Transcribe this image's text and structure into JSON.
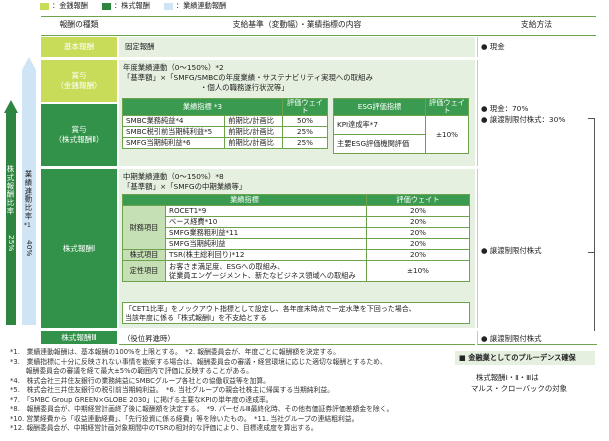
{
  "legend": [
    {
      "label": "：金銭報酬",
      "color": "#c8dc5a"
    },
    {
      "label": "：株式報酬",
      "color": "#2e8540"
    },
    {
      "label": "：業績連動報酬",
      "color": "#cfe4f4"
    }
  ],
  "header": {
    "col1": "報酬の種類",
    "col2": "支給基準（変動幅）・業績指標の内容",
    "col3": "支給方法"
  },
  "left_labels": {
    "stock_ratio": "株式報酬比率",
    "stock_pct": "25%",
    "perf_ratio": "業績連動比率",
    "perf_note": "*1",
    "perf_pct": "40%"
  },
  "rows": {
    "base": {
      "label": "基本報酬",
      "content": "固定報酬",
      "pay": "● 現金"
    },
    "bonus_cash": {
      "label1": "賞与",
      "label2": "（金銭報酬）"
    },
    "bonus_stock": {
      "label1": "賞与",
      "label2": "（株式報酬Ⅱ）"
    },
    "bonus_line1": "年度業績連動（0～150%）*2",
    "bonus_line2": "「基準額」×「SMFG/SMBCの年度業績・サステナビリティ実現への取組み",
    "bonus_line3": "・個人の職務遂行状況等」",
    "bonus_pay1": "● 現金：70%",
    "bonus_pay2": "● 譲渡制限付株式：30%",
    "stock1": {
      "label": "株式報酬Ⅰ",
      "line1": "中期業績連動（0～150%）*8",
      "line2": "「基準額」×「SMFGの中期業績等」",
      "pay": "● 譲渡制限付株式"
    },
    "stock1_note1": "「CET1比率」をノックアウト指標として設定し、各年度末時点で一定水準を下回った場合、",
    "stock1_note2": "当該年度に係る「株式報酬Ⅰ」を不支給とする",
    "stock3": {
      "label": "株式報酬Ⅲ",
      "content": "（役位昇進時）",
      "pay": "● 譲渡制限付株式"
    }
  },
  "table_perf": {
    "head": [
      "業績指標 *3",
      "評価ウェイト"
    ],
    "rows": [
      [
        "SMBC業務純益*4",
        "前期比/計画比",
        "50%"
      ],
      [
        "SMBC税引前当期純利益*5",
        "前期比/計画比",
        "25%"
      ],
      [
        "SMFG当期純利益*6",
        "前期比/計画比",
        "25%"
      ]
    ]
  },
  "table_esg": {
    "head": [
      "ESG評価指標",
      "評価ウェイト"
    ],
    "rows": [
      [
        "KPI達成率*7"
      ],
      [
        "主要ESG評価機関評価"
      ]
    ],
    "weight": "±10%"
  },
  "table_mid": {
    "head": [
      "業績指標",
      "評価ウェイト"
    ],
    "cats": [
      "財務項目",
      "株式項目",
      "定性項目"
    ],
    "rows": [
      [
        "ROCET1*9",
        "20%"
      ],
      [
        "ベース経費*10",
        "20%"
      ],
      [
        "SMFG業務粗利益*11",
        "20%"
      ],
      [
        "SMFG当期純利益",
        "20%"
      ],
      [
        "TSR(株主総利回り)*12",
        "20%"
      ]
    ],
    "qual1": "お客さま満足度、ESGへの取組み、",
    "qual2": "従業員エンゲージメント、新たなビジネス領域への取組み",
    "qual_weight": "±10%"
  },
  "prudence": {
    "title": "■ 金融業としてのプルーデンス確保",
    "line1": "株式報酬Ⅰ・Ⅱ・Ⅲは",
    "line2": "マルス・クローバックの対象"
  },
  "footnotes": [
    "*1.　業績連動報酬は、基本報酬の100%を上限とする。　*2. 報酬委員会が、年度ごとに報酬額を決定する。",
    "*3.　業績指標に十分に反映されない事情を勘案する場合は、報酬委員会の審議・経営環境に応じた適切な報酬とするため、",
    "　　 報酬委員会の審議を経て最大±5%の範囲内で評価に反映することがある。",
    "*4.　株式会社三井住友銀行の業務純益にSMBCグループ各社との協働収益等を加算。",
    "*5.　株式会社三井住友銀行の税引前当期純利益。　*6. 当社グループの親会社株主に帰属する当期純利益。",
    "*7.　「SMBC Group GREEN×GLOBE 2030」に掲げる主要なKPIの単年度の達成率。",
    "*8.　報酬委員会が、中期経営計画終了後に報酬額を決定する。　*9. パーゼルⅢ最終化時、その他有価証券評価差額金を除く。",
    "*10. 営業経費から「収益連動経費」、「先行投資に係る経費」等を除いたもの。　*11. 当社グループの連結粗利益。",
    "*12. 報酬委員会が、中期経営計画対象期間中のTSRの相対的な評価により、目標達成度を算出する。"
  ]
}
